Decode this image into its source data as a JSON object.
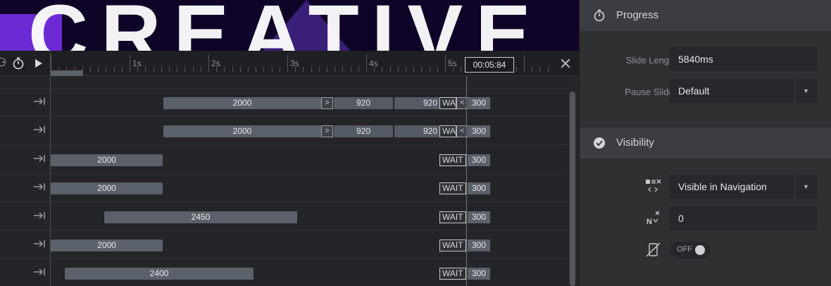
{
  "preview": {
    "word": "CREATIVE"
  },
  "toolbar": {
    "stopwatch_icon": "stopwatch-icon",
    "play_icon": "play-icon",
    "time": "00:05:84",
    "close_icon": "close-icon"
  },
  "ruler": {
    "labels": [
      "1s",
      "2s",
      "3s",
      "4s",
      "5s"
    ]
  },
  "tracks": [
    {
      "in": "2000",
      "next": ">",
      "mid": "920",
      "mid2": "920",
      "wait": "WA",
      "prev": "<",
      "out": "300"
    },
    {
      "in": "2000",
      "next": ">",
      "mid": "920",
      "mid2": "920",
      "wait": "WA",
      "prev": "<",
      "out": "300"
    },
    {
      "in": "2000",
      "wait": "WAIT",
      "out": "300"
    },
    {
      "in": "2000",
      "wait": "WAIT",
      "out": "300"
    },
    {
      "in": "2450",
      "wait": "WAIT",
      "out": "300"
    },
    {
      "in": "2000",
      "wait": "WAIT",
      "out": "300"
    },
    {
      "in": "2400",
      "wait": "WAIT",
      "out": "300"
    }
  ],
  "progress": {
    "title": "Progress",
    "slide_length_label": "Slide Length",
    "slide_length_value": "5840ms",
    "pause_slider_label": "Pause Slider",
    "pause_slider_value": "Default"
  },
  "visibility": {
    "title": "Visibility",
    "navigation_value": "Visible in Navigation",
    "nav_offset_value": "0",
    "toggle_label": "OFF"
  },
  "colors": {
    "accent_purple": "#6b2ad3",
    "panel_bg": "#2f3032",
    "segment": "#5b616b"
  }
}
